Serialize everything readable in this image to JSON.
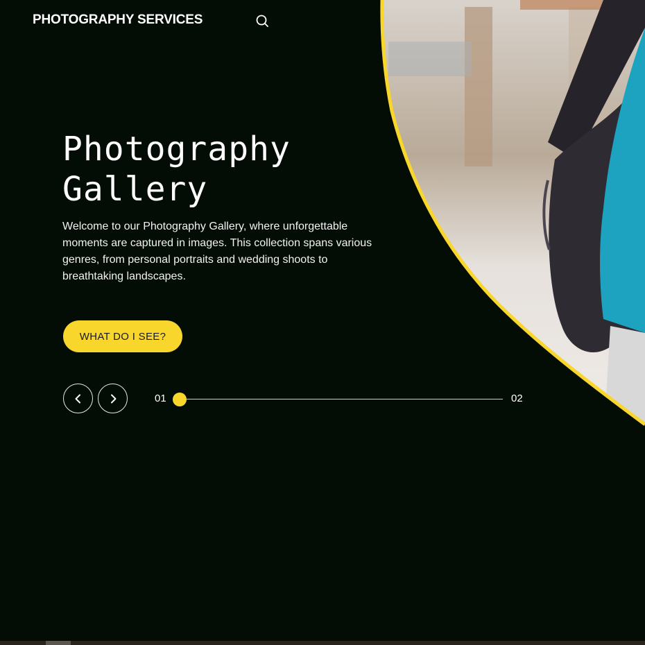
{
  "header": {
    "brand": "PHOTOGRAPHY SERVICES",
    "search_icon": "search-icon"
  },
  "hero": {
    "title_line1": "Photography",
    "title_line2": "Gallery",
    "description": "Welcome to our Photography Gallery, where unforgettable moments are captured in images. This collection spans various genres, from personal portraits and wedding shoots to breathtaking landscapes.",
    "cta_label": "WHAT DO I SEE?",
    "photo_icon": "photo-of-person-with-backpack"
  },
  "slider": {
    "current": "01",
    "total": "02",
    "progress": 0,
    "prev_icon": "chevron-left-icon",
    "next_icon": "chevron-right-icon"
  },
  "colors": {
    "background": "#040d05",
    "accent": "#f9d62c",
    "text": "#ffffff"
  }
}
